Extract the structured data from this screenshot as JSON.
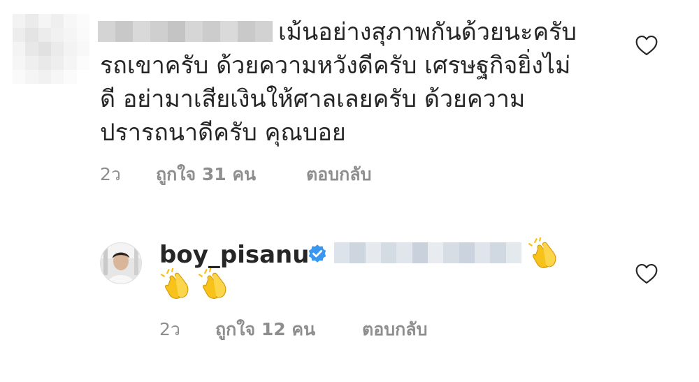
{
  "comments": [
    {
      "text": "เม้นอย่างสุภาพกันด้วยนะครับ\nรถเขาครับ ด้วยความหวังดีครับ เศรษฐกิจยิ่งไม่\nดี อย่ามาเสียเงินให้ศาลเลยครับ ด้วยความ\nปรารถนาดีครับ คุณบอย",
      "time": "2ว",
      "likes": "ถูกใจ 31 คน",
      "reply": "ตอบกลับ"
    },
    {
      "username": "boy_pisanu",
      "time": "2ว",
      "likes": "ถูกใจ 12 คน",
      "reply": "ตอบกลับ"
    }
  ],
  "icons": {
    "heart": "heart-icon",
    "verified": "verified-badge-icon",
    "clap": "clapping-hands-emoji"
  },
  "colors": {
    "text": "#262626",
    "meta": "#8e8e8e",
    "verified": "#3897f0",
    "clap": "#f7c31a"
  }
}
